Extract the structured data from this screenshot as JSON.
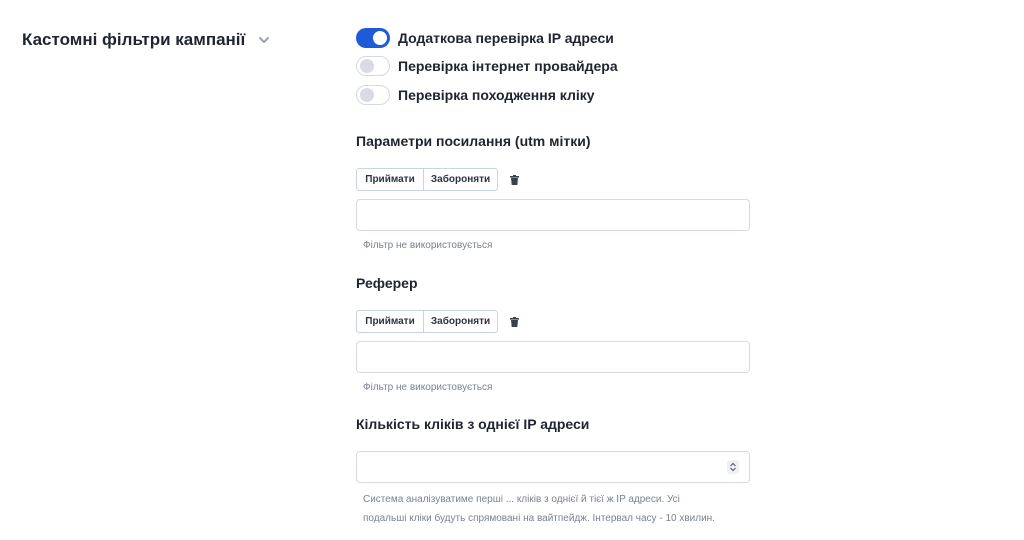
{
  "section": {
    "title": "Кастомні фільтри кампанії",
    "chevron_icon": "chevron-down-icon"
  },
  "toggles": [
    {
      "label": "Додаткова перевірка IP адреси",
      "state": "on"
    },
    {
      "label": "Перевірка інтернет провайдера",
      "state": "off"
    },
    {
      "label": "Перевірка походження кліку",
      "state": "off"
    }
  ],
  "utm": {
    "title": "Параметри посилання (utm мітки)",
    "allow_label": "Приймати",
    "deny_label": "Забороняти",
    "trash_icon": "trash-icon",
    "value": "",
    "hint": "Фільтр не використовується"
  },
  "referer": {
    "title": "Реферер",
    "allow_label": "Приймати",
    "deny_label": "Забороняти",
    "trash_icon": "trash-icon",
    "value": "",
    "hint": "Фільтр не використовується"
  },
  "clicks": {
    "title": "Кількість кліків з однієї IP адреси",
    "value": "",
    "hint_line1": "Система аналізуватиме перші ... кліків з однієї й тієї ж IP адреси. Усі",
    "hint_line2": "подальші кліки будуть спрямовані на вайтпейдж. Інтервал часу - 10 хвилин."
  },
  "colors": {
    "accent": "#1f5ad8",
    "text": "#1f2430",
    "muted": "#7b8290",
    "border": "#d6dae2"
  }
}
